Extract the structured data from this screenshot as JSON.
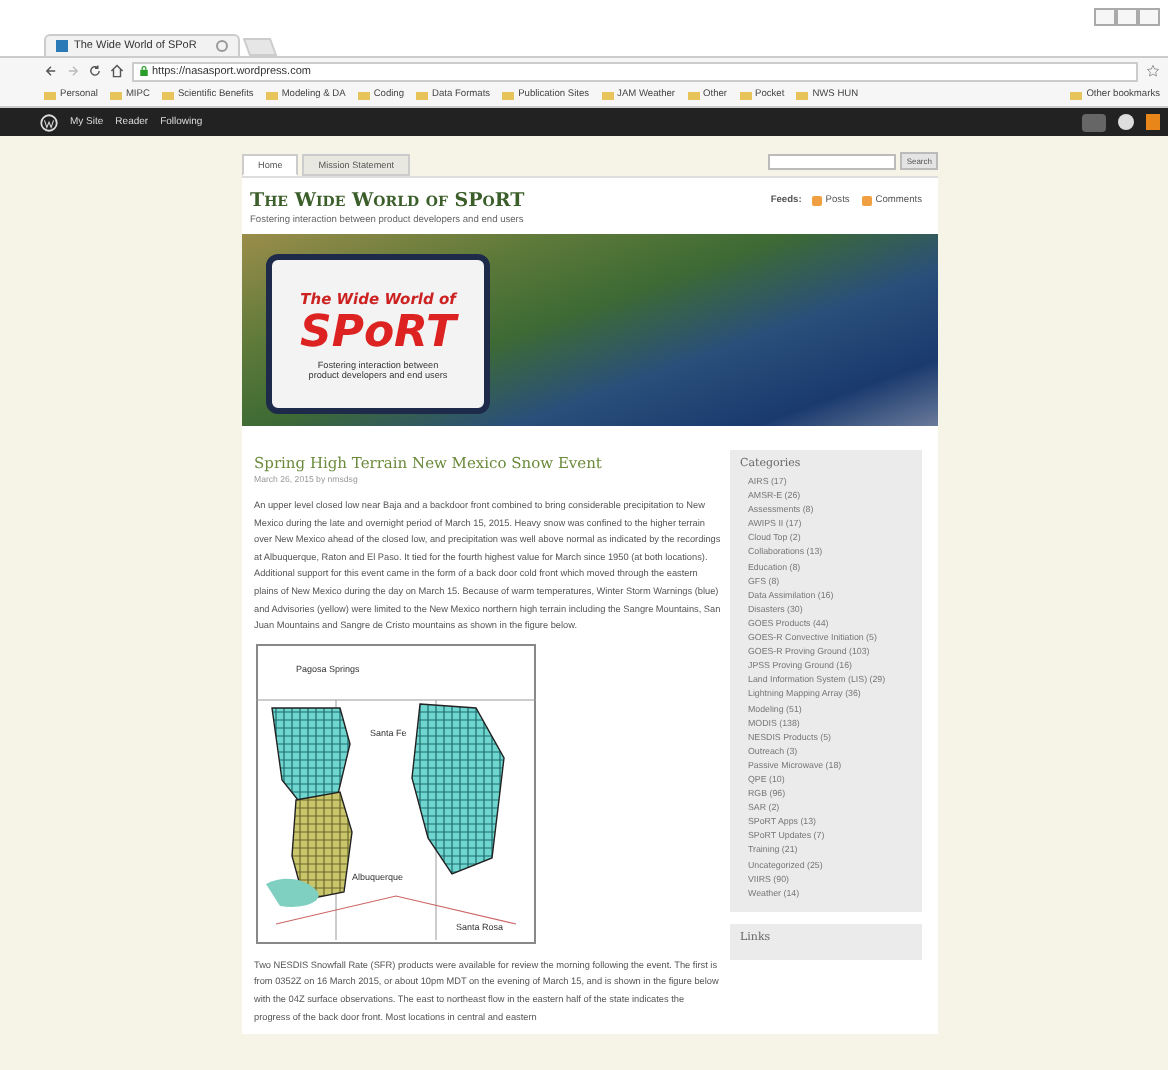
{
  "browser": {
    "tab_title": "The Wide World of SPoR",
    "url": "https://nasasport.wordpress.com",
    "bookmarks": [
      "Personal",
      "MIPC",
      "Scientific Benefits",
      "Modeling & DA",
      "Coding",
      "Data Formats",
      "Publication Sites",
      "JAM Weather",
      "Other",
      "Pocket",
      "NWS HUN"
    ],
    "other_bookmarks": "Other bookmarks"
  },
  "admin_bar": {
    "items": [
      "My Site",
      "Reader",
      "Following"
    ]
  },
  "blog": {
    "nav": [
      {
        "label": "Home",
        "selected": true
      },
      {
        "label": "Mission Statement",
        "selected": false
      }
    ],
    "search_button": "Search",
    "title": "The Wide World of SPoRT",
    "tagline": "Fostering interaction between product developers and end users",
    "feeds_label": "Feeds:",
    "feeds": [
      "Posts",
      "Comments"
    ],
    "banner": {
      "logo_top": "The Wide World of",
      "logo_main": "SPoRT",
      "logo_sub": "Fostering interaction between product developers and end users"
    }
  },
  "post": {
    "title": "Spring High Terrain New Mexico Snow Event",
    "meta": "March 26, 2015 by nmsdsg",
    "paragraph1": "An upper level closed low near Baja and a backdoor front combined to bring considerable precipitation to New Mexico during the late and overnight period of March 15, 2015. Heavy snow was confined to the higher terrain over New Mexico ahead of the closed low, and precipitation was well above normal as indicated by the recordings at Albuquerque, Raton and El Paso. It tied for the fourth highest value for March since 1950 (at both locations). Additional support for this event came in the form of a back door cold front which moved through the eastern plains of New Mexico during the day on March 15. Because of warm temperatures, Winter Storm Warnings (blue) and Advisories (yellow) were limited to the New Mexico northern high terrain including the Sangre Mountains, San Juan Mountains and Sangre de Cristo mountains as shown in the figure below.",
    "map_labels": [
      "Pagosa Springs",
      "Santa Fe",
      "Albuquerque",
      "Santa Rosa"
    ],
    "paragraph2": "Two NESDIS Snowfall Rate (SFR) products were available for review the morning following the event. The first is from 0352Z on 16 March 2015, or about 10pm MDT on the evening of March 15, and is shown in the figure below with the 04Z surface observations. The east to northeast flow in the eastern half of the state indicates the progress of the back door front. Most locations in central and eastern"
  },
  "sidebar": {
    "categories_title": "Categories",
    "categories": [
      "AIRS (17)",
      "AMSR-E (26)",
      "Assessments (8)",
      "AWIPS II (17)",
      "Cloud Top (2)",
      "Collaborations (13)",
      "Education (8)",
      "GFS (8)",
      "Data Assimilation (16)",
      "Disasters (30)",
      "GOES Products (44)",
      "GOES-R Convective Initiation (5)",
      "GOES-R Proving Ground (103)",
      "JPSS Proving Ground (16)",
      "Land Information System (LIS) (29)",
      "Lightning Mapping Array (36)",
      "Modeling (51)",
      "MODIS (138)",
      "NESDIS Products (5)",
      "Outreach (3)",
      "Passive Microwave (18)",
      "QPE (10)",
      "RGB (96)",
      "SAR (2)",
      "SPoRT Apps (13)",
      "SPoRT Updates (7)",
      "Training (21)",
      "Uncategorized (25)",
      "VIIRS (90)",
      "Weather (14)"
    ],
    "links_title": "Links"
  }
}
